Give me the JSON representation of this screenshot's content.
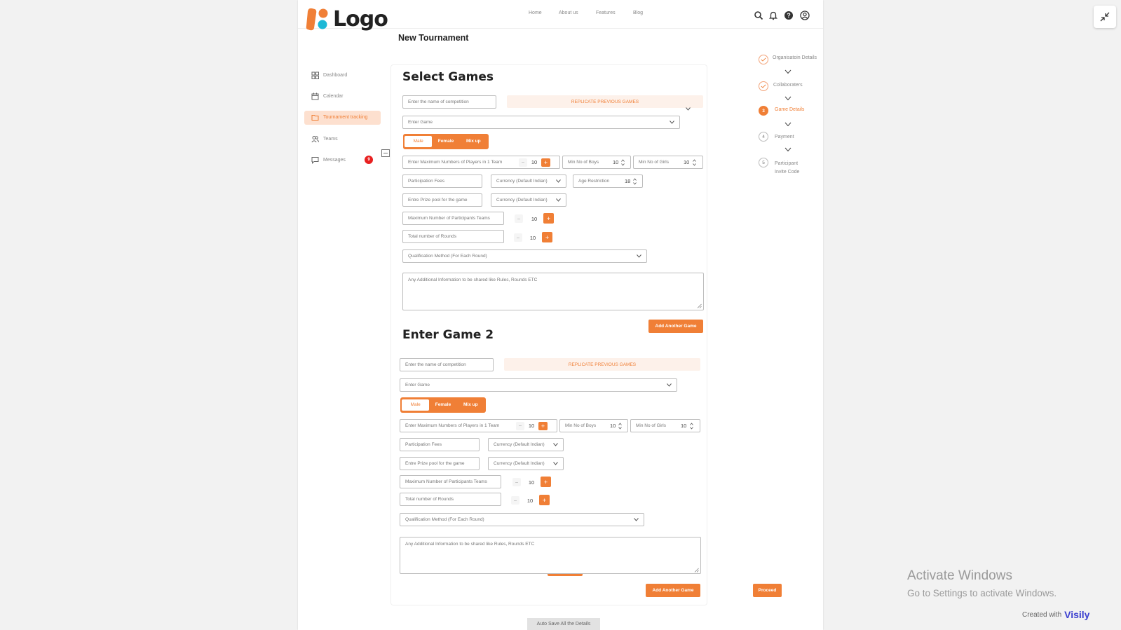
{
  "header": {
    "logo_text": "Logo",
    "nav": [
      "Home",
      "About us",
      "Features",
      "Blog"
    ]
  },
  "page_title": "New Tournament",
  "sidebar": {
    "items": [
      {
        "label": "Dashboard",
        "icon": "dashboard-icon"
      },
      {
        "label": "Calendar",
        "icon": "calendar-icon"
      },
      {
        "label": "Tournament tracking",
        "icon": "folder-icon",
        "active": true
      },
      {
        "label": "Teams",
        "icon": "teams-icon"
      },
      {
        "label": "Messages",
        "icon": "message-icon",
        "badge": "9"
      }
    ]
  },
  "colors": {
    "accent": "#f07f36",
    "accent_light": "#fde0cf",
    "badge": "#e82020"
  },
  "games": [
    {
      "heading": "Select Games",
      "competition_placeholder": "Enter the name of competition",
      "replicate_label": "REPLICATE PREVIOUS GAMES",
      "game_select": "Enter Game",
      "gender_options": [
        "Male",
        "Female",
        "Mix up"
      ],
      "selected_gender": "Male",
      "max_players_label": "Enter Maximum Numbers of Players in 1 Team",
      "max_players_value": "10",
      "min_boys_label": "Min No of Boys",
      "min_boys_value": "10",
      "min_girls_label": "Min No of Girls",
      "min_girls_value": "10",
      "fees_placeholder": "Participation Fees",
      "currency_1": "Currency (Default Indian)",
      "age_label": "Age Restriction",
      "age_value": "18",
      "prize_placeholder": "Entre Prize pool for the game",
      "currency_2": "Currency (Default Indian)",
      "max_teams_label": "Maximum Number of Participants Teams",
      "max_teams_value": "10",
      "rounds_label": "Total number of Rounds",
      "rounds_value": "10",
      "qualification_select": "Qualification Method (For Each Round)",
      "info_placeholder": "Any Additional Information to be shared like Rules, Rounds  ETC",
      "add_button": "Add Another Game"
    },
    {
      "heading": "Enter Game 2",
      "competition_placeholder": "Enter the name of competition",
      "replicate_label": "REPLICATE PREVIOUS GAMES",
      "game_select": "Enter Game",
      "gender_options": [
        "Male",
        "Female",
        "Mix up"
      ],
      "selected_gender": "Male",
      "max_players_label": "Enter Maximum Numbers of Players in 1 Team",
      "max_players_value": "10",
      "min_boys_label": "Min No of Boys",
      "min_boys_value": "10",
      "min_girls_label": "Min No of Girls",
      "min_girls_value": "10",
      "fees_placeholder": "Participation Fees",
      "currency_1": "Currency (Default Indian)",
      "prize_placeholder": "Entre Prize pool for the game",
      "currency_2": "Currency (Default Indian)",
      "max_teams_label": "Maximum Number of Participants Teams",
      "max_teams_value": "10",
      "rounds_label": "Total number of Rounds",
      "rounds_value": "10",
      "qualification_select": "Qualification Method (For Each Round)",
      "info_placeholder": "Any Additional Information to be shared like Rules, Rounds  ETC",
      "add_button": "Add Another Game"
    }
  ],
  "steps": [
    {
      "label": "Organisatoin Details",
      "state": "done"
    },
    {
      "label": "Collaboraters",
      "state": "done"
    },
    {
      "number": "3",
      "label": "Game Details",
      "state": "active"
    },
    {
      "number": "4",
      "label": "Payment",
      "state": "pending"
    },
    {
      "number": "5",
      "label": "Participant Invite Code",
      "state": "pending"
    }
  ],
  "proceed_button": "Proceed",
  "autosave_button": "Auto Save All the Details",
  "os_watermark": {
    "line1": "Activate Windows",
    "line2": "Go to Settings to activate Windows."
  },
  "credit": {
    "prefix": "Created with",
    "brand": "Visily"
  }
}
